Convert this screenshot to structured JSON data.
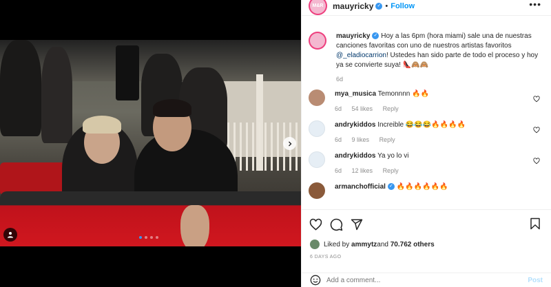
{
  "post": {
    "username": "mauyricky",
    "follow_label": "Follow",
    "more_label": "•••",
    "caption_user": "mauyricky",
    "caption_text": "Hoy a las 6pm (hora miami) sale una de nuestras canciones favoritas con uno de nuestros artistas favoritos ",
    "caption_mention": "@_eladiocarrion",
    "caption_rest": "! Ustedes han sido parte de todo el proceso y hoy ya se convierte suya! 👠🙈🙈",
    "caption_age": "6d"
  },
  "comments": [
    {
      "user": "mya_musica",
      "text": "Temonnnn 🔥🔥",
      "age": "6d",
      "likes": "54 likes",
      "reply": "Reply",
      "color": "#b98c73"
    },
    {
      "user": "andrykiddos",
      "text": "Increible 😂😂😂🔥🔥🔥🔥",
      "age": "6d",
      "likes": "9 likes",
      "reply": "Reply",
      "color": "#e6eef5"
    },
    {
      "user": "andrykiddos",
      "text": "Ya yo lo vi",
      "age": "6d",
      "likes": "12 likes",
      "reply": "Reply",
      "color": "#e6eef5"
    },
    {
      "user": "armanchofficial",
      "text": "🔥🔥🔥🔥🔥🔥",
      "age": "",
      "likes": "",
      "reply": "",
      "color": "#8a5a3a"
    }
  ],
  "likes": {
    "prefix": "Liked by ",
    "user": "ammytz",
    "middle": " and ",
    "count": "70.762 others"
  },
  "date": "6 DAYS AGO",
  "add_comment": {
    "placeholder": "Add a comment...",
    "post_label": "Post"
  },
  "icons": {
    "next": "chevron-right-icon",
    "tag": "user-tag-icon",
    "heart": "heart-icon",
    "comment": "comment-icon",
    "share": "share-icon",
    "bookmark": "bookmark-icon",
    "emoji": "emoji-icon",
    "verified": "verified-badge-icon"
  },
  "colors": {
    "accent": "#0095f6",
    "verified": "#3897f0",
    "story_ring": "#ee3f7e"
  }
}
